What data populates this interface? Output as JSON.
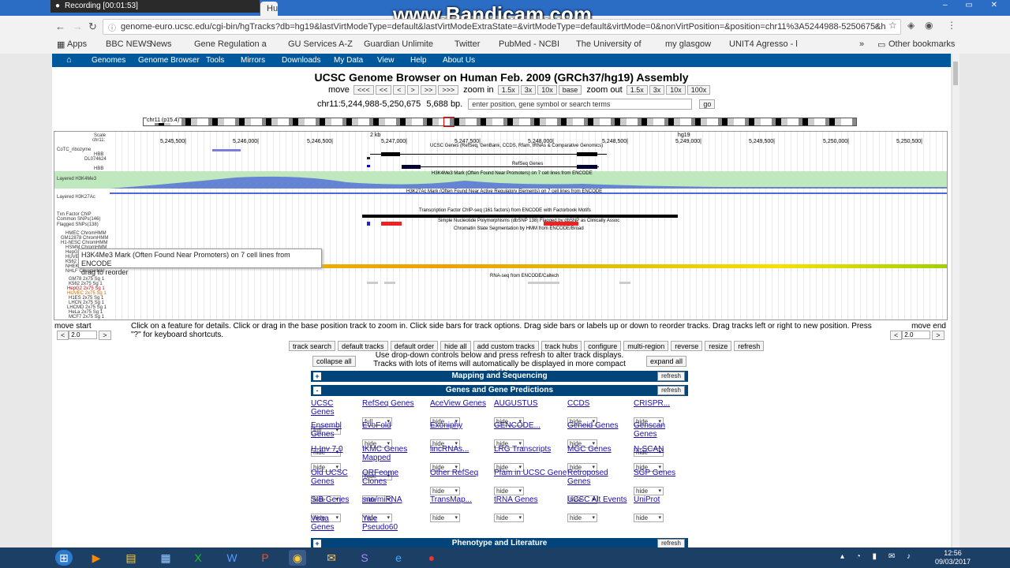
{
  "recorder": {
    "title": "Recording [00:01:53]",
    "watermark": "www.Bandicam.com"
  },
  "browser": {
    "tabs": [
      "Hum... Ge..."
    ],
    "url": "genome-euro.ucsc.edu/cgi-bin/hgTracks?db=hg19&lastVirtModeType=default&lastVirtModeExtraState=&virtModeType=default&virtMode=0&nonVirtPosition=&position=chr11%3A5244988-5250675&h",
    "bookmarks": [
      "Apps",
      "BBC NEWS",
      "News",
      "Gene Regulation a",
      "GU Services A-Z",
      "Guardian Unlimite",
      "Twitter",
      "PubMed - NCBI",
      "The University of",
      "my glasgow",
      "UNIT4 Agresso - l",
      "»",
      "Other bookmarks"
    ]
  },
  "nav": {
    "items": [
      "Genomes",
      "Genome Browser",
      "Tools",
      "Mirrors",
      "Downloads",
      "My Data",
      "View",
      "Help",
      "About Us"
    ]
  },
  "title": "UCSC Genome Browser on Human Feb. 2009 (GRCh37/hg19) Assembly",
  "move": {
    "label": "move",
    "buttons": [
      "<<<",
      "<<",
      "<",
      ">",
      ">>",
      ">>>"
    ],
    "zoom_in": "zoom in",
    "zoom_in_buttons": [
      "1.5x",
      "3x",
      "10x",
      "base"
    ],
    "zoom_out": "zoom out",
    "zoom_out_buttons": [
      "1.5x",
      "3x",
      "10x",
      "100x"
    ]
  },
  "position": {
    "value": "chr11:5,244,988-5,250,675",
    "size": "5,688 bp.",
    "placeholder": "enter position, gene symbol or search terms",
    "go": "go"
  },
  "ideogram_label": "chr11 (p15.4)",
  "ruler": {
    "scale": "Scale",
    "chrom": "chr11:",
    "ticks": [
      "5,245,500|",
      "5,246,000|",
      "5,246,500|",
      "5,247,000|",
      "5,247,500|",
      "5,248,000|",
      "5,248,500|",
      "5,249,000|",
      "5,249,500|",
      "5,250,000|",
      "5,250,500|"
    ],
    "kb": "2 kb",
    "db": "hg19"
  },
  "track_labels": [
    "CoTC_ribozyme",
    "HBB",
    "DL074624",
    "HBB",
    "Layered H3K4Me3",
    "Layered H3K27Ac",
    "Txn Factor ChIP",
    "Common SNPs(146)",
    "Flagged SNPs(138)",
    "HMEC ChromHMM",
    "GM12878 ChromHMM",
    "H1-hESC ChromHMM",
    "HSMM ChromHMM",
    "HepG2 ChromHMM",
    "HUVEC ChromHMM",
    "K562 ChromHMM",
    "NHEK ChromHMM",
    "NHLF ChromHMM",
    "GM78 2x75 Sg 1",
    "K562 2x75 Sg 1",
    "HepG2 2x75 Sg 1",
    "HUVEC 2x75 Sg 1",
    "H1ES 2x75 Sg 1",
    "LHCN 2x75 Sg 1",
    "LHCMD 2x75 Sg 1",
    "HeLa 2x75 Sg 1",
    "MCF7 2x75 Sg 1"
  ],
  "track_titles": [
    "UCSC Genes (RefSeq, GenBank, CCDS, Rfam, tRNAs & Comparative Genomics)",
    "RefSeq Genes",
    "H3K4Me3 Mark (Often Found Near Promoters) on 7 cell lines from ENCODE",
    "H3K27Ac Mark (Often Found Near Active Regulatory Elements) on 7 cell lines from ENCODE",
    "Transcription Factor ChIP-seq (161 factors) from ENCODE with Factorbook Motifs",
    "Simple Nucleotide Polymorphisms (dbSNP 138) Flagged by dbSNP as Clinically Assoc",
    "Chromatin State Segmentation by HMM from ENCODE/Broad",
    "RNA-seq from ENCODE/Caltech"
  ],
  "tooltip": {
    "line1": "H3K4Me3 Mark (Often Found Near Promoters) on 7 cell lines from ENCODE",
    "line2": "drag to reorder"
  },
  "help": {
    "move_start": "move start",
    "move_end": "move end",
    "step": "2.0",
    "text": "Click on a feature for details. Click or drag in the base position track to zoom in. Click side bars for track options. Drag side bars or labels up or down to reorder tracks. Drag tracks left or right to new position. Press \"?\" for keyboard shortcuts."
  },
  "buttons": [
    "track search",
    "default tracks",
    "default order",
    "hide all",
    "add custom tracks",
    "track hubs",
    "configure",
    "multi-region",
    "reverse",
    "resize",
    "refresh"
  ],
  "controls": {
    "collapse_all": "collapse all",
    "expand_all": "expand all",
    "info1": "Use drop-down controls below and press refresh to alter track displays.",
    "info2": "Tracks with lots of items will automatically be displayed in more compact modes."
  },
  "groups": [
    {
      "sign": "+",
      "name": "Mapping and Sequencing",
      "refresh": "refresh"
    },
    {
      "sign": "-",
      "name": "Genes and Gene Predictions",
      "refresh": "refresh"
    },
    {
      "sign": "+",
      "name": "Phenotype and Literature",
      "refresh": "refresh"
    }
  ],
  "gene_tracks": [
    {
      "name": "UCSC Genes",
      "mode": "full"
    },
    {
      "name": "RefSeq Genes",
      "mode": "full"
    },
    {
      "name": "AceView Genes",
      "mode": "hide"
    },
    {
      "name": "AUGUSTUS",
      "mode": "hide"
    },
    {
      "name": "CCDS",
      "mode": "hide"
    },
    {
      "name": "CRISPR...",
      "mode": "hide"
    },
    {
      "name": "Ensembl Genes",
      "mode": "hide"
    },
    {
      "name": "EvoFold",
      "mode": "hide"
    },
    {
      "name": "Exoniphy",
      "mode": "hide"
    },
    {
      "name": "GENCODE...",
      "mode": "hide"
    },
    {
      "name": "Geneid Genes",
      "mode": "hide"
    },
    {
      "name": "Genscan Genes",
      "mode": "hide"
    },
    {
      "name": "H-Inv 7.0",
      "mode": "hide"
    },
    {
      "name": "IKMC Genes Mapped",
      "mode": "hide"
    },
    {
      "name": "lincRNAs...",
      "mode": "hide"
    },
    {
      "name": "LRG Transcripts",
      "mode": "hide"
    },
    {
      "name": "MGC Genes",
      "mode": "hide"
    },
    {
      "name": "N-SCAN",
      "mode": "hide"
    },
    {
      "name": "Old UCSC Genes",
      "mode": "hide"
    },
    {
      "name": "ORFeome Clones",
      "mode": "hide"
    },
    {
      "name": "Other RefSeq",
      "mode": "hide"
    },
    {
      "name": "Pfam in UCSC Gene",
      "mode": "hide"
    },
    {
      "name": "Retroposed Genes",
      "mode": "hide"
    },
    {
      "name": "SGP Genes",
      "mode": "hide"
    },
    {
      "name": "SIB Genes",
      "mode": "hide"
    },
    {
      "name": "sno/miRNA",
      "mode": "hide"
    },
    {
      "name": "TransMap...",
      "mode": "hide"
    },
    {
      "name": "tRNA Genes",
      "mode": "hide"
    },
    {
      "name": "UCSC Alt Events",
      "mode": "hide"
    },
    {
      "name": "UniProt",
      "mode": "hide"
    },
    {
      "name": "Vega Genes",
      "mode": "hide"
    },
    {
      "name": "Yale Pseudo60",
      "mode": "hide"
    }
  ],
  "clock": {
    "time": "12:56",
    "date": "09/03/2017"
  }
}
